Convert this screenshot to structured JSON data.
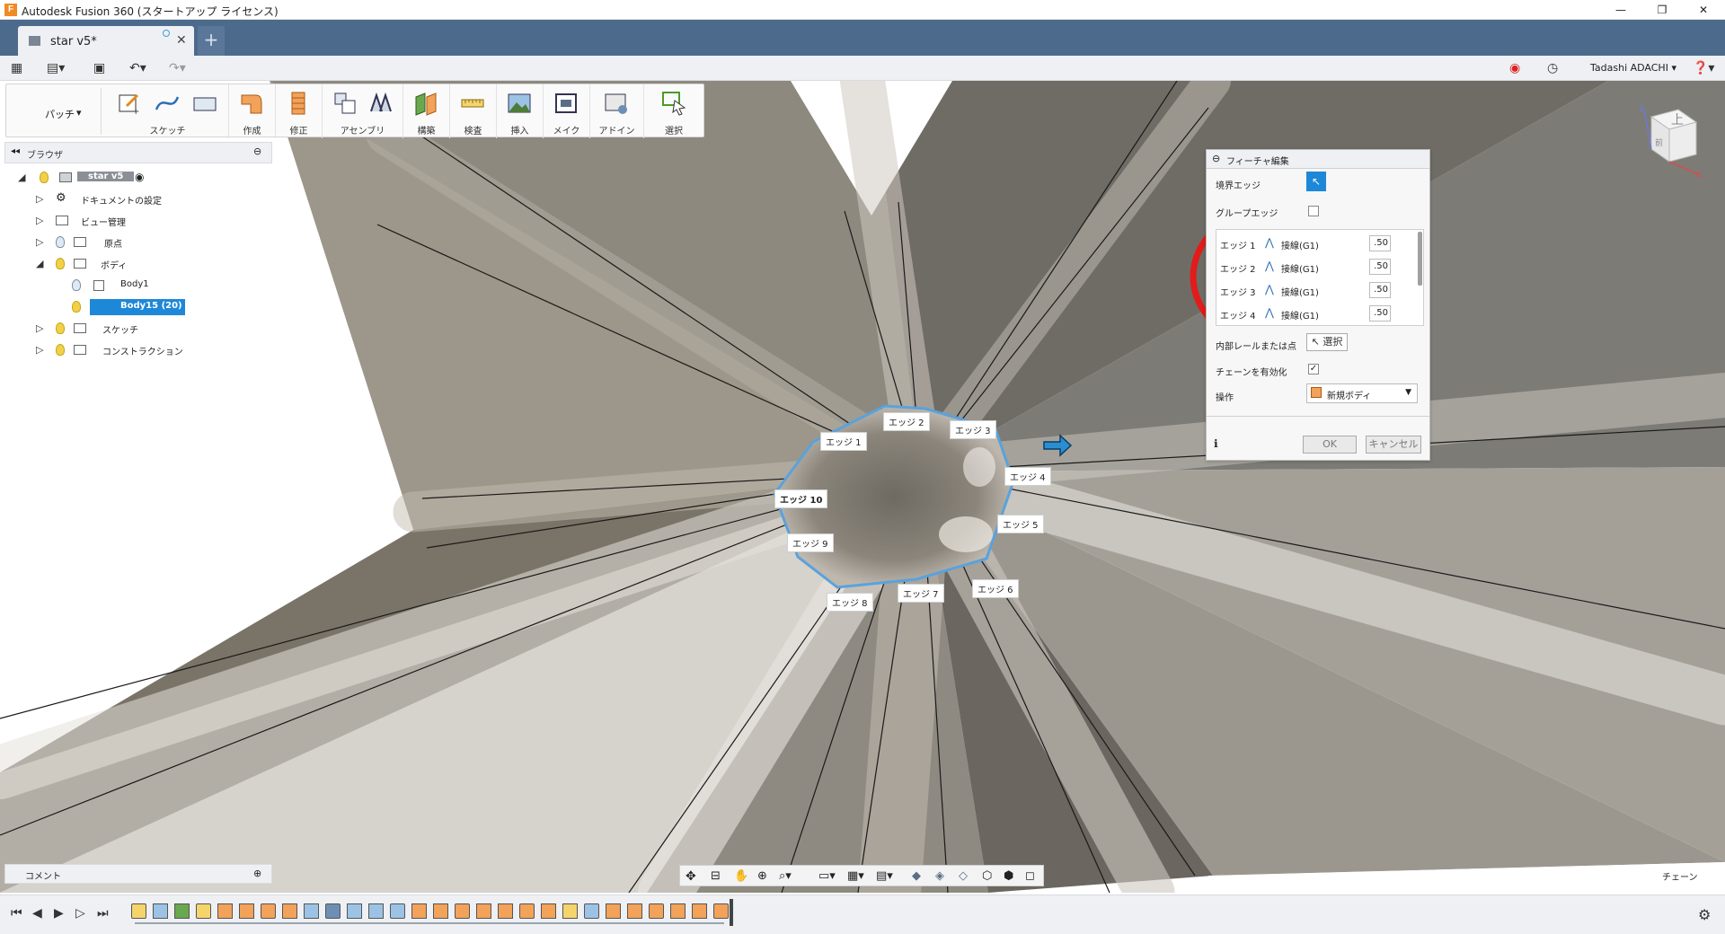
{
  "window": {
    "title": "Autodesk Fusion 360 (スタートアップ ライセンス)"
  },
  "tabs": [
    {
      "label": "star v5*"
    }
  ],
  "user": {
    "name": "Tadashi ADACHI"
  },
  "ribbon": {
    "workspace": "パッチ",
    "groups": [
      "スケッチ",
      "作成",
      "修正",
      "アセンブリ",
      "構築",
      "検査",
      "挿入",
      "メイク",
      "アドイン",
      "選択"
    ]
  },
  "browser": {
    "title": "ブラウザ",
    "items": [
      {
        "label": "star v5"
      },
      {
        "label": "ドキュメントの設定"
      },
      {
        "label": "ビュー管理"
      },
      {
        "label": "原点"
      },
      {
        "label": "ボディ"
      },
      {
        "label": "Body1"
      },
      {
        "label": "Body15 (20)"
      },
      {
        "label": "スケッチ"
      },
      {
        "label": "コンストラクション"
      }
    ]
  },
  "comment": {
    "label": "コメント"
  },
  "viewcube": {
    "face": "上",
    "side": "前",
    "axis_x": "X",
    "axis_z": "Z"
  },
  "panel": {
    "title": "フィーチャ編集",
    "boundary_label": "境界エッジ",
    "group_label": "グループエッジ",
    "edges": [
      {
        "name": "エッジ 1",
        "kind": "接線(G1)",
        "value": ".50"
      },
      {
        "name": "エッジ 2",
        "kind": "接線(G1)",
        "value": ".50"
      },
      {
        "name": "エッジ 3",
        "kind": "接線(G1)",
        "value": ".50"
      },
      {
        "name": "エッジ 4",
        "kind": "接線(G1)",
        "value": ".50"
      }
    ],
    "rail_label": "内部レールまたは点",
    "rail_button": "選択",
    "chain_label": "チェーンを有効化",
    "operation_label": "操作",
    "operation_value": "新規ボディ",
    "ok": "OK",
    "cancel": "キャンセル"
  },
  "edge_labels": [
    "エッジ 1",
    "エッジ 2",
    "エッジ 3",
    "エッジ 4",
    "エッジ 5",
    "エッジ 6",
    "エッジ 7",
    "エッジ 8",
    "エッジ 9",
    "エッジ 10"
  ],
  "status": {
    "chain": "チェーン"
  }
}
